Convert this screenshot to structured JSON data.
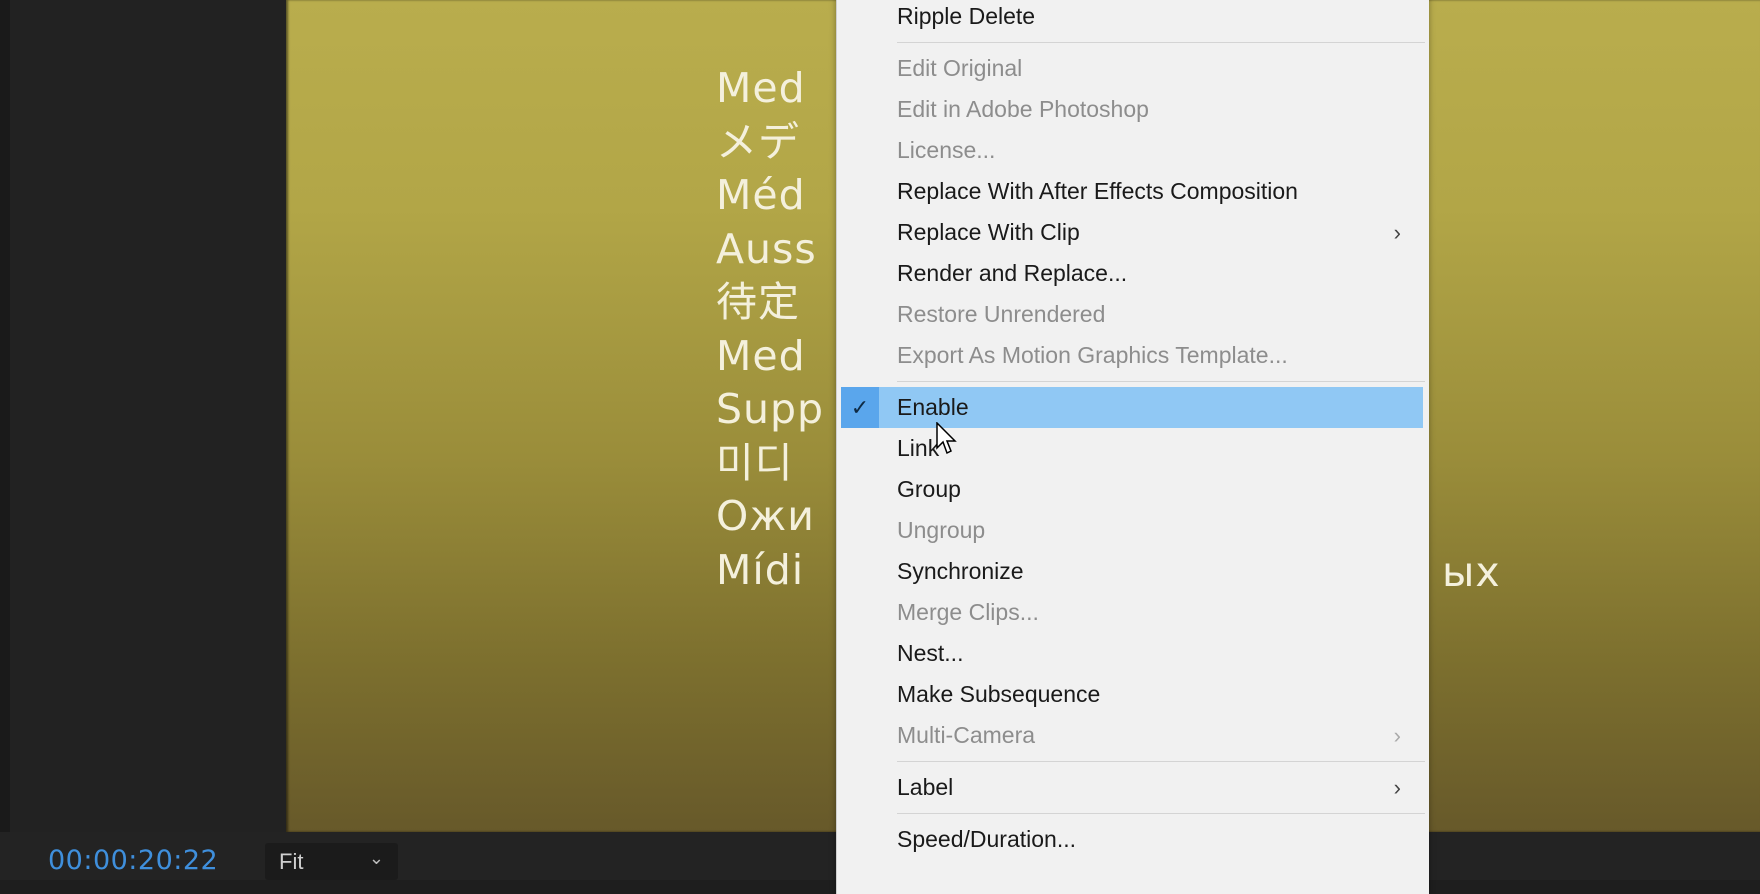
{
  "app": {
    "timecode": "00:00:20:22",
    "zoom_select": {
      "selected": "Fit"
    }
  },
  "viewer": {
    "overlay_lines": [
      "Med",
      "メデ",
      "Méd",
      "Auss",
      "待定",
      "Med",
      "Supp",
      "미디",
      "Ожи",
      "Mídi"
    ],
    "overlay_suffix": "ых",
    "background_color": "#b2a647"
  },
  "context_menu": {
    "highlight_color": "#90c8f4",
    "groups": [
      [
        {
          "label": "Ripple Delete",
          "enabled": true
        }
      ],
      [
        {
          "label": "Edit Original",
          "enabled": false
        },
        {
          "label": "Edit in Adobe Photoshop",
          "enabled": false
        },
        {
          "label": "License...",
          "enabled": false
        },
        {
          "label": "Replace With After Effects Composition",
          "enabled": true
        },
        {
          "label": "Replace With Clip",
          "enabled": true,
          "submenu": true
        },
        {
          "label": "Render and Replace...",
          "enabled": true
        },
        {
          "label": "Restore Unrendered",
          "enabled": false
        },
        {
          "label": "Export As Motion Graphics Template...",
          "enabled": false
        }
      ],
      [
        {
          "label": "Enable",
          "enabled": true,
          "checked": true,
          "highlighted": true
        },
        {
          "label": "Link",
          "enabled": true
        },
        {
          "label": "Group",
          "enabled": true
        },
        {
          "label": "Ungroup",
          "enabled": false
        },
        {
          "label": "Synchronize",
          "enabled": true
        },
        {
          "label": "Merge Clips...",
          "enabled": false
        },
        {
          "label": "Nest...",
          "enabled": true
        },
        {
          "label": "Make Subsequence",
          "enabled": true
        },
        {
          "label": "Multi-Camera",
          "enabled": false,
          "submenu": true
        }
      ],
      [
        {
          "label": "Label",
          "enabled": true,
          "submenu": true
        }
      ],
      [
        {
          "label": "Speed/Duration...",
          "enabled": true
        }
      ]
    ],
    "check_glyph": "✓",
    "submenu_glyph": "›"
  }
}
